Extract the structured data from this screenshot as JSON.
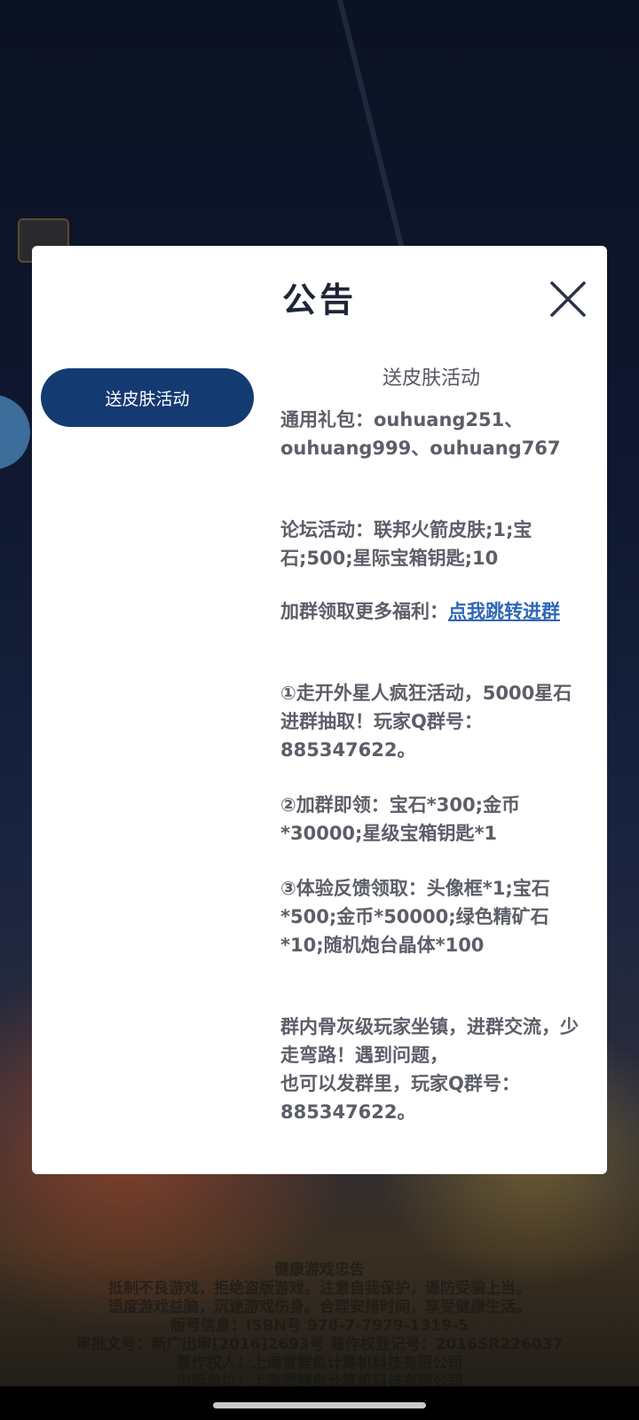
{
  "dialog": {
    "title": "公告",
    "side_tabs": [
      {
        "label": "送皮肤活动"
      }
    ],
    "content": {
      "heading": "送皮肤活动",
      "gift_codes": "通用礼包：ouhuang251、ouhuang999、ouhuang767",
      "forum_event": "论坛活动：联邦火箭皮肤;1;宝石;500;星际宝箱钥匙;10",
      "join_group_prefix": "加群领取更多福利：",
      "join_group_link": "点我跳转进群",
      "item1": "①走开外星人疯狂活动，5000星石进群抽取！玩家Q群号：885347622。",
      "item2": "②加群即领：宝石*300;金币*30000;星级宝箱钥匙*1",
      "item3": "③体验反馈领取：头像框*1;宝石*500;金币*50000;绿色精矿石*10;随机炮台晶体*100",
      "closing_line1": "群内骨灰级玩家坐镇，进群交流，少走弯路！遇到问题，",
      "closing_line2": "也可以发群里，玩家Q群号：885347622。"
    }
  },
  "footer": {
    "lines": [
      "健康游戏忠告",
      "抵制不良游戏，拒绝盗版游戏。注意自我保护，谨防受骗上当。",
      "适度游戏益脑，沉迷游戏伤身。合理安排时间，享受健康生活。",
      "版号信息：ISBN号 978-7-7979-1319-5",
      "审批文号：新广出审[2016]2693号  著作权登记号：2016SR226037",
      "著作权人：上海雪鲤鱼计算机科技有限公司",
      "出版单位：上海雪鲤鱼计算机科技有限公司"
    ]
  },
  "icons": {
    "close": "close-icon"
  },
  "colors": {
    "tab_active_bg": "#143a72",
    "link": "#2e67b8",
    "title": "#1e2536"
  }
}
